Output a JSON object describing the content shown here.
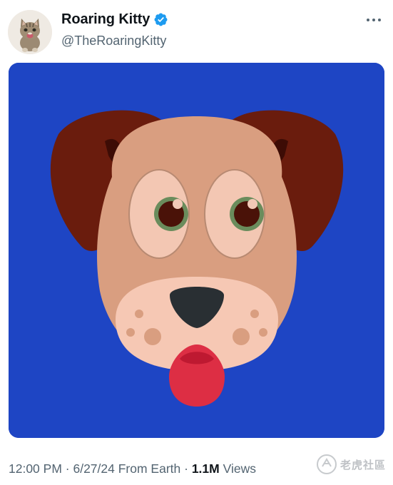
{
  "tweet": {
    "author": {
      "display_name": "Roaring Kitty",
      "handle": "@TheRoaringKitty",
      "verified": true,
      "verified_color": "#1d9bf0",
      "avatar_icon": "kitten-avatar"
    },
    "more_icon": "ellipsis-icon",
    "media": {
      "description_icon": "dog-face-emoji",
      "background_color": "#1e45c4"
    },
    "meta": {
      "time": "12:00 PM",
      "separator1": " · ",
      "date": "6/27/24",
      "source": "From Earth",
      "separator2": " · ",
      "views_count": "1.1M",
      "views_label": "Views"
    }
  },
  "watermark": {
    "text": "老虎社區"
  }
}
